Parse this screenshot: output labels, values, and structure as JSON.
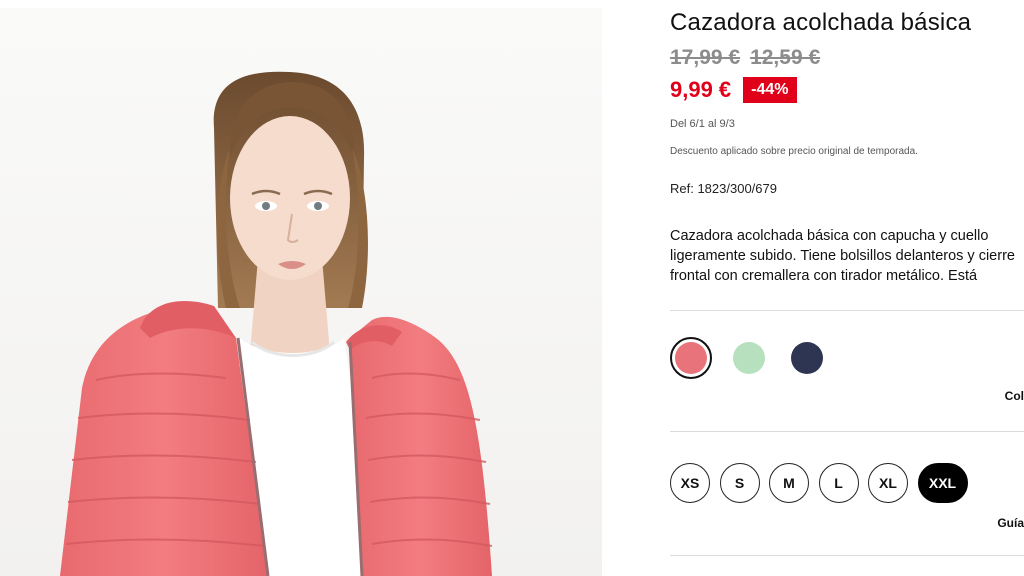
{
  "product": {
    "title": "Cazadora acolchada básica",
    "original_prices": [
      "17,99 €",
      "12,59 €"
    ],
    "current_price": "9,99 €",
    "discount": "-44%",
    "promo_dates": "Del 6/1 al 9/3",
    "discount_note": "Descuento aplicado sobre precio original de temporada.",
    "ref": "Ref: 1823/300/679",
    "description": "Cazadora acolchada básica con capucha y cuello ligeramente subido. Tiene bolsillos delanteros y cierre frontal con cremallera con tirador metálico. Está",
    "image_alt": "Modelo con cazadora acolchada coral"
  },
  "colors": {
    "label": "Col",
    "swatches": [
      {
        "name": "coral",
        "hex": "#e8737a",
        "selected": true
      },
      {
        "name": "mint",
        "hex": "#b6e0be",
        "selected": false
      },
      {
        "name": "navy",
        "hex": "#2e3552",
        "selected": false
      }
    ]
  },
  "sizes": {
    "options": [
      "XS",
      "S",
      "M",
      "L",
      "XL",
      "XXL"
    ],
    "selected": "XXL",
    "guide_label": "Guía"
  },
  "theme": {
    "accent": "#e1001a",
    "jacket": "#ef7478",
    "text": "#111111"
  }
}
